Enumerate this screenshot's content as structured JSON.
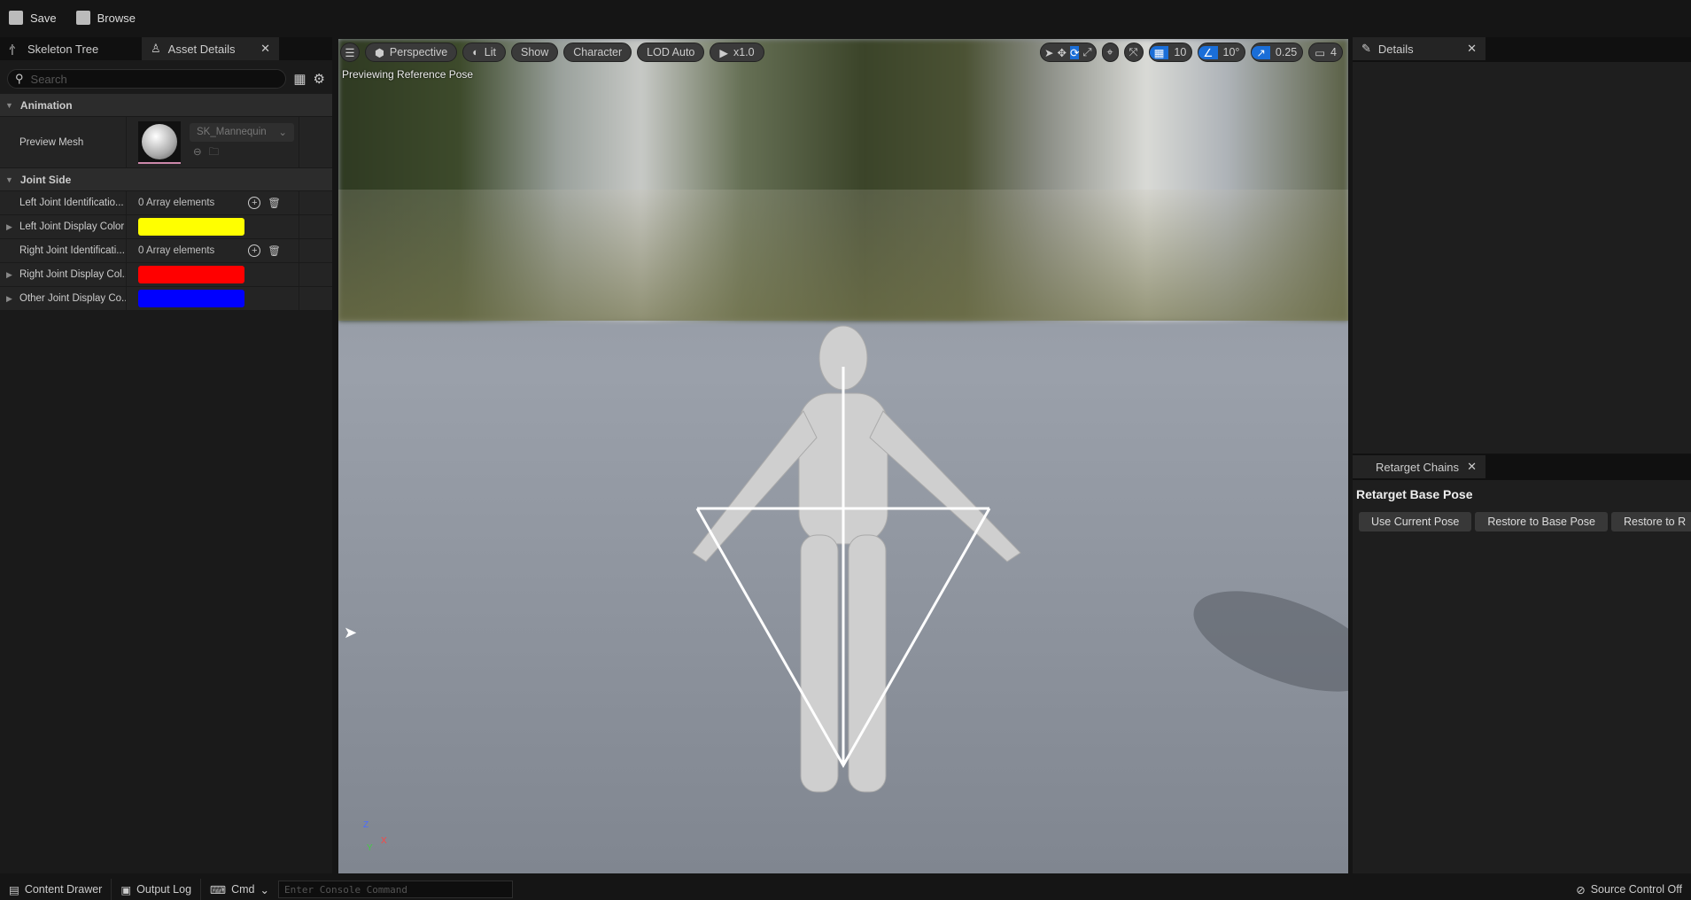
{
  "topbar": {
    "save": "Save",
    "browse": "Browse"
  },
  "left": {
    "tabs": [
      "Skeleton Tree",
      "Asset Details"
    ],
    "search_placeholder": "Search",
    "categories": {
      "animation": "Animation",
      "joint_side": "Joint Side"
    },
    "preview_mesh": {
      "label": "Preview Mesh",
      "value": "SK_Mannequin"
    },
    "rows": [
      {
        "label": "Left Joint Identificatio...",
        "value": "0 Array elements"
      },
      {
        "label": "Left Joint Display Color",
        "color": "#ffff00"
      },
      {
        "label": "Right Joint Identificati...",
        "value": "0 Array elements"
      },
      {
        "label": "Right Joint Display Col...",
        "color": "#ff0000"
      },
      {
        "label": "Other Joint Display Co...",
        "color": "#0000ff"
      }
    ]
  },
  "viewport": {
    "perspective": "Perspective",
    "lit": "Lit",
    "show": "Show",
    "character": "Character",
    "lod": "LOD Auto",
    "speed": "x1.0",
    "status": "Previewing Reference Pose",
    "grid": "10",
    "angle": "10°",
    "scale": "0.25",
    "camera_speed": "4",
    "axis": {
      "z": "Z",
      "x": "X",
      "y": "Y"
    }
  },
  "right": {
    "details_tab": "Details",
    "chains_tab": "Retarget Chains",
    "title": "Retarget Base Pose",
    "buttons": [
      "Use Current Pose",
      "Restore to Base Pose",
      "Restore to R"
    ]
  },
  "bottom": {
    "content_drawer": "Content Drawer",
    "output_log": "Output Log",
    "cmd": "Cmd",
    "console_placeholder": "Enter Console Command",
    "source_control": "Source Control Off"
  }
}
